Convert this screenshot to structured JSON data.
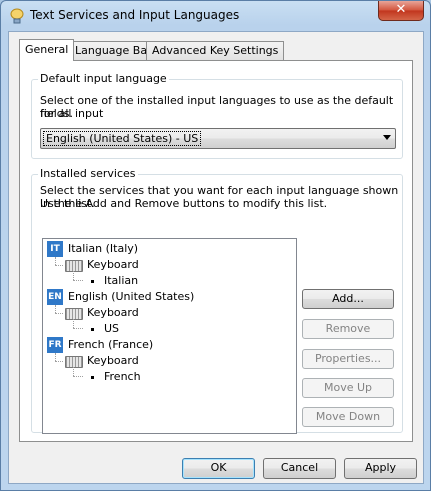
{
  "window": {
    "title": "Text Services and Input Languages",
    "close_label": "✕"
  },
  "tabs": [
    {
      "label": "General",
      "active": true
    },
    {
      "label": "Language Bar",
      "active": false
    },
    {
      "label": "Advanced Key Settings",
      "active": false
    }
  ],
  "default_input": {
    "group_title": "Default input language",
    "description_line1": "Select one of the installed input languages to use as the default for all input",
    "description_line2": "fields.",
    "selected": "English (United States) - US"
  },
  "installed": {
    "group_title": "Installed services",
    "description_line1": "Select the services that you want for each input language shown in the list.",
    "description_line2": "Use the Add and Remove buttons to modify this list.",
    "languages": [
      {
        "badge": "IT",
        "name": "Italian (Italy)",
        "category": "Keyboard",
        "layout": "Italian"
      },
      {
        "badge": "EN",
        "name": "English (United States)",
        "category": "Keyboard",
        "layout": "US"
      },
      {
        "badge": "FR",
        "name": "French (France)",
        "category": "Keyboard",
        "layout": "French"
      }
    ],
    "buttons": {
      "add": "Add...",
      "remove": "Remove",
      "properties": "Properties...",
      "move_up": "Move Up",
      "move_down": "Move Down"
    }
  },
  "dialog_buttons": {
    "ok": "OK",
    "cancel": "Cancel",
    "apply": "Apply"
  },
  "colors": {
    "lang_badge": "#2f78c8",
    "close_button": "#c1351d"
  }
}
